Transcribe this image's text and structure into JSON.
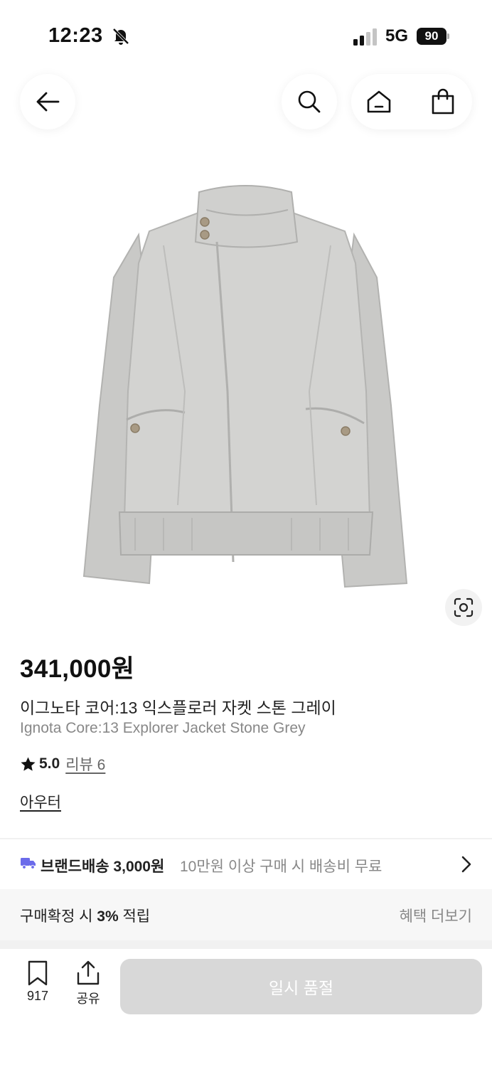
{
  "status_bar": {
    "time": "12:23",
    "network": "5G",
    "battery": "90"
  },
  "nav": {
    "back_icon": "back-arrow-icon",
    "search_icon": "search-icon",
    "home_icon": "home-icon",
    "bag_icon": "shopping-bag-icon"
  },
  "product": {
    "image_icon": "gray-jacket-photo",
    "price": "341,000원",
    "name_ko": "이그노타 코어:13 익스플로러 자켓 스톤 그레이",
    "name_en": "Ignota Core:13 Explorer Jacket Stone Grey",
    "rating": "5.0",
    "reviews": "리뷰 6",
    "category": "아우터"
  },
  "shipping": {
    "label": "브랜드배송 3,000원",
    "sub": "10만원 이상 구매 시 배송비 무료"
  },
  "points": {
    "prefix": "구매확정 시 ",
    "rate": "3%",
    "suffix": " 적립",
    "more": "혜택 더보기"
  },
  "bottom_bar": {
    "bookmark_count": "917",
    "share_label": "공유",
    "cta": "일시 품절"
  },
  "colors": {
    "accent_truck": "#6B6BEA",
    "cta_disabled": "#D8D8D8"
  }
}
